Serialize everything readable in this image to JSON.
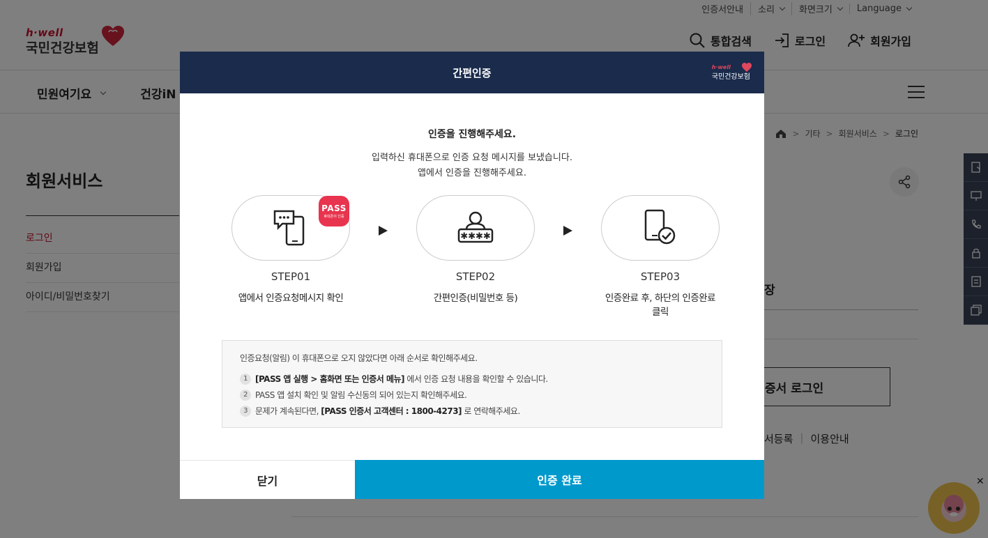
{
  "util_bar": {
    "items": [
      "인증서안내",
      "소리",
      "화면크기",
      "Language"
    ]
  },
  "logo": {
    "brand": "h·well",
    "name": "국민건강보험"
  },
  "top_actions": {
    "search": "통합검색",
    "login": "로그인",
    "signup": "회원가입"
  },
  "gnb": {
    "menu": [
      "민원여기요",
      "건강iN"
    ]
  },
  "breadcrumb": [
    "기타",
    "회원서비스",
    "로그인"
  ],
  "sidebar": {
    "title": "회원서비스",
    "items": [
      {
        "label": "로그인"
      },
      {
        "label": "회원가입"
      },
      {
        "label": "아이디/비밀번호찾기"
      }
    ]
  },
  "content": {
    "partial_heading": "장",
    "cert_button": "증서 로그인",
    "links": [
      "서등록",
      "이용안내"
    ]
  },
  "modal": {
    "title": "간편인증",
    "logo_brand": "h·well",
    "logo_name": "국민건강보험",
    "heading": "인증을 진행해주세요.",
    "desc_line1": "입력하신 휴대폰으로 인증 요청 메시지를 보냈습니다.",
    "desc_line2": "앱에서 인증을 진행해주세요.",
    "steps": [
      {
        "label": "STEP01",
        "desc": "앱에서 인증요청메시지 확인",
        "icon": "phone-message-icon"
      },
      {
        "label": "STEP02",
        "desc": "간편인증(비밀번호 등)",
        "icon": "user-password-icon"
      },
      {
        "label": "STEP03",
        "desc": "인증완료 후, 하단의 인증완료 클릭",
        "icon": "phone-check-icon"
      }
    ],
    "pass_badge": {
      "title": "PASS",
      "sub": "휴대폰이 인증"
    },
    "info": {
      "intro": "인증요청(알림) 이 휴대폰으로 오지 않았다면 아래 순서로 확인해주세요.",
      "items": [
        {
          "num": "1",
          "bold": "[PASS 앱 실행 > 홈화면 또는 인증서 메뉴]",
          "text": " 에서 인증 요청 내용을 확인할 수 있습니다."
        },
        {
          "num": "2",
          "bold": "",
          "text": "PASS 앱 설치 확인 및 알림 수신동의 되어 있는지 확인해주세요."
        },
        {
          "num": "3",
          "pre": "문제가 계속된다면, ",
          "bold": "[PASS 인증서 고객센터 : 1800-4273]",
          "text": " 로 연락해주세요."
        }
      ]
    },
    "close_label": "닫기",
    "done_label": "인증 완료"
  },
  "colors": {
    "modal_header": "#1a2b4c",
    "primary_button": "#0099cc",
    "brand_red": "#c8102e",
    "pass_red": "#e8344e"
  }
}
